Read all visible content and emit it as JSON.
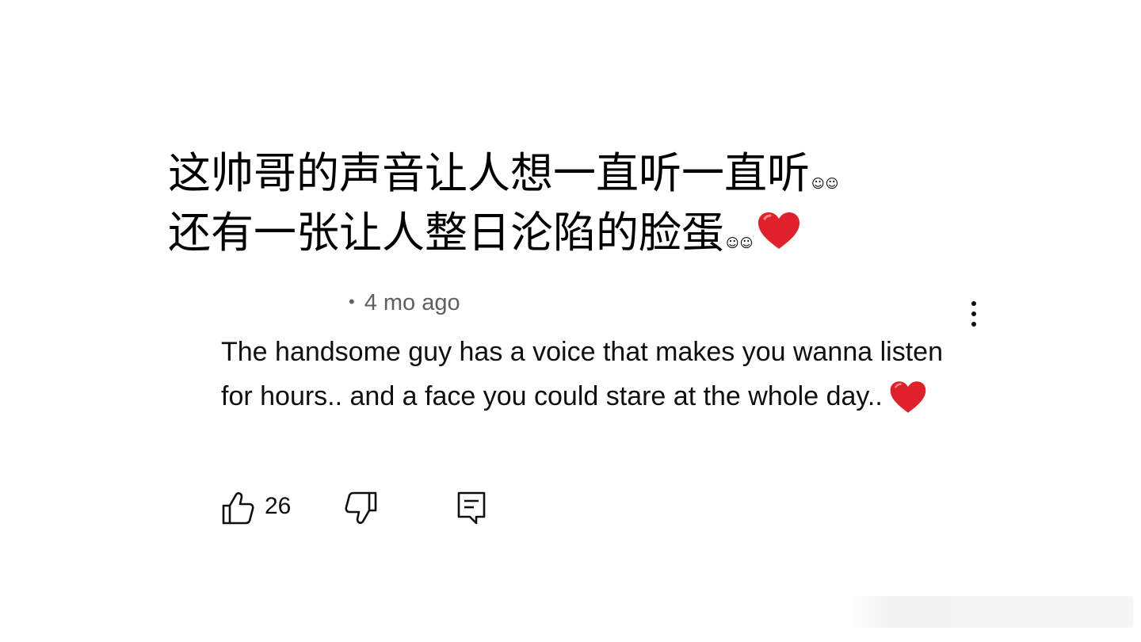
{
  "caption": {
    "line1": "这帅哥的声音让人想一直听一直听",
    "line1_emoji": "☺☺",
    "line2": "还有一张让人整日沦陷的脸蛋",
    "line2_emoji": "☺☺",
    "heart_icon": "red-heart-emoji"
  },
  "comment": {
    "meta_dot": "•",
    "time_ago": "4 mo ago",
    "text": "The handsome guy has a voice that makes you wanna listen for hours.. and a face you could stare at the whole day..",
    "heart_icon": "red-heart-emoji",
    "like_count": "26",
    "colors": {
      "text": "#0f0f0f",
      "meta": "#606060",
      "heart": "#e0202a"
    }
  }
}
